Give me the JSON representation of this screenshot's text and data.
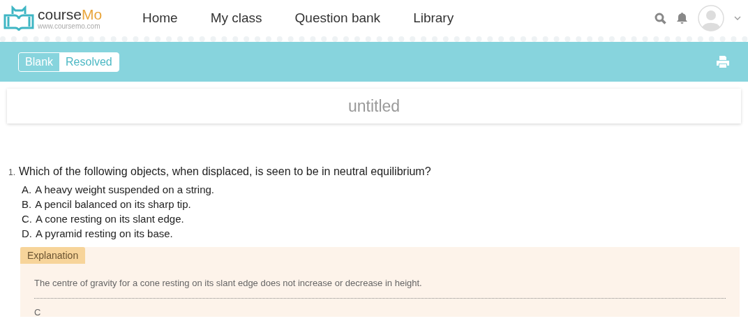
{
  "header": {
    "brand_parts": [
      "course",
      "Mo"
    ],
    "brand_url": "www.coursemo.com",
    "nav": [
      {
        "label": "Home"
      },
      {
        "label": "My class"
      },
      {
        "label": "Question bank"
      },
      {
        "label": "Library"
      }
    ]
  },
  "toolbar": {
    "toggle": [
      {
        "label": "Blank",
        "selected": true
      },
      {
        "label": "Resolved",
        "selected": false
      }
    ]
  },
  "title": "untitled",
  "questions": [
    {
      "number": "1.",
      "text": "Which of the following objects, when displaced, is seen to be in neutral equilibrium?",
      "options": [
        {
          "letter": "A.",
          "text": "A heavy weight suspended on a string."
        },
        {
          "letter": "B.",
          "text": "A pencil balanced on its sharp tip."
        },
        {
          "letter": "C.",
          "text": "A cone resting on its slant edge."
        },
        {
          "letter": "D.",
          "text": "A pyramid resting on its base."
        }
      ],
      "explanation": {
        "label": "Explanation",
        "text": "The centre of gravity for a cone resting on its slant edge does not increase or decrease in height.",
        "answer": "C"
      }
    }
  ]
}
